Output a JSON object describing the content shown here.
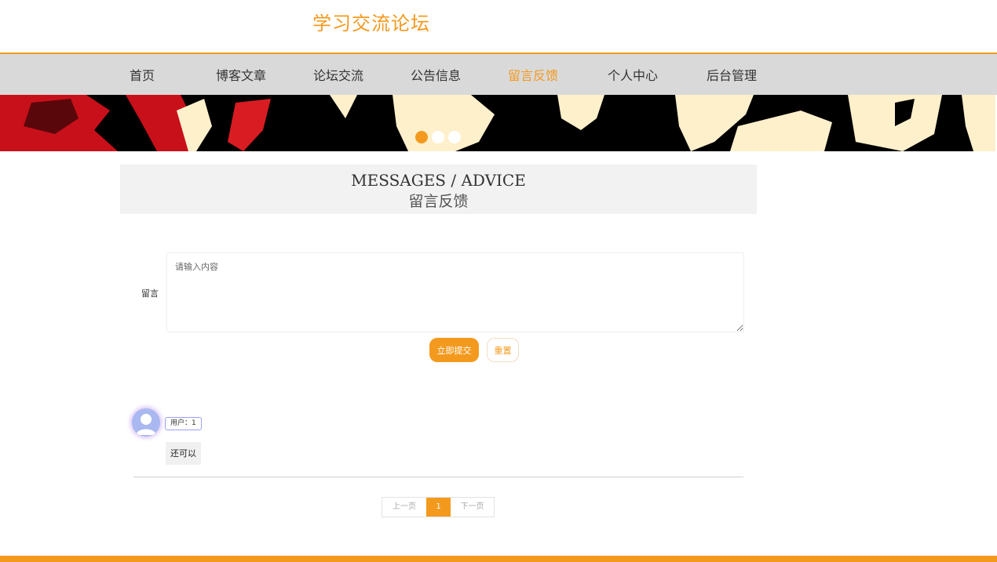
{
  "site": {
    "title": "学习交流论坛"
  },
  "nav": {
    "items": [
      {
        "label": "首页"
      },
      {
        "label": "博客文章"
      },
      {
        "label": "论坛交流"
      },
      {
        "label": "公告信息"
      },
      {
        "label": "留言反馈",
        "active": true
      },
      {
        "label": "个人中心"
      },
      {
        "label": "后台管理"
      }
    ]
  },
  "banner": {
    "active_slide": 1,
    "slide_count": 3
  },
  "section": {
    "title_en": "MESSAGES / ADVICE",
    "title_cn": "留言反馈"
  },
  "form": {
    "label": "留言",
    "placeholder": "请输入内容",
    "value": "",
    "submit_label": "立即提交",
    "reset_label": "重置"
  },
  "comments": [
    {
      "user": "用户：1",
      "text": "还可以"
    }
  ],
  "pagination": {
    "prev_label": "上一页",
    "current": "1",
    "next_label": "下一页"
  },
  "colors": {
    "accent": "#f39a1e",
    "nav_bg": "#d9d9d9",
    "section_bg": "#f2f2f2"
  }
}
